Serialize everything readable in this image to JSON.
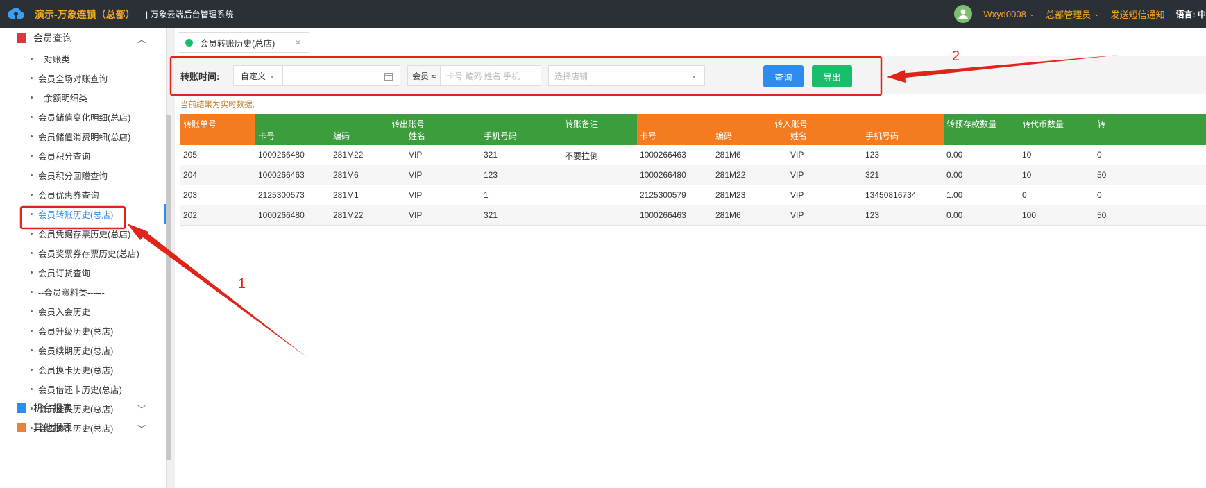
{
  "header": {
    "brand": "演示-万象连锁（总部）",
    "subtitle": "| 万象云端后台管理系统",
    "user": "Wxyd0008",
    "role": "总部管理员",
    "sms": "发送短信通知",
    "lang_label": "语言:",
    "lang_value": "中"
  },
  "sidebar": {
    "group_member": "会员查询",
    "items": [
      "--对账类------------",
      "会员全场对账查询",
      "--余额明细类------------",
      "会员储值变化明细(总店)",
      "会员储值消费明细(总店)",
      "会员积分查询",
      "会员积分回赠查询",
      "会员优惠券查询",
      "会员转账历史(总店)",
      "会员凭据存票历史(总店)",
      "会员奖票券存票历史(总店)",
      "会员订货查询",
      "--会员资料类------",
      "会员入会历史",
      "会员升级历史(总店)",
      "会员续期历史(总店)",
      "会员换卡历史(总店)",
      "会员借还卡历史(总店)",
      "会员挂失历史(总店)",
      "会员退卡历史(总店)"
    ],
    "active_index": 8,
    "group_machine": "机台报表",
    "group_other": "其他报表"
  },
  "tab": {
    "label": "会员转账历史(总店)",
    "close": "×"
  },
  "filter": {
    "label": "转账时间:",
    "range_select": "自定义",
    "date_value": "",
    "member_prefix": "会员 ≈",
    "member_placeholder": "卡号 编码 姓名 手机",
    "store_placeholder": "选择店铺",
    "query_button": "查询",
    "export_button": "导出"
  },
  "notice": "当前结果为实时数据;",
  "table": {
    "headers": {
      "order_no": "转账单号",
      "out_group": "转出账号",
      "remark": "转账备注",
      "in_group": "转入账号",
      "prepaid": "转预存款数量",
      "coin": "转代币数量",
      "more": "转",
      "card": "卡号",
      "code": "编码",
      "name": "姓名",
      "phone": "手机号码"
    },
    "rows": [
      [
        "205",
        "1000266480",
        "281M22",
        "VIP",
        "321",
        "不要拉倒",
        "1000266463",
        "281M6",
        "VIP",
        "123",
        "0.00",
        "10",
        "0"
      ],
      [
        "204",
        "1000266463",
        "281M6",
        "VIP",
        "123",
        "",
        "1000266480",
        "281M22",
        "VIP",
        "321",
        "0.00",
        "10",
        "50"
      ],
      [
        "203",
        "2125300573",
        "281M1",
        "VIP",
        "1",
        "",
        "2125300579",
        "281M23",
        "VIP",
        "13450816734",
        "1.00",
        "0",
        "0"
      ],
      [
        "202",
        "1000266480",
        "281M22",
        "VIP",
        "321",
        "",
        "1000266463",
        "281M6",
        "VIP",
        "123",
        "0.00",
        "100",
        "50"
      ]
    ]
  },
  "annotations": {
    "one": "1",
    "two": "2"
  },
  "colors": {
    "orange": "#f47b20",
    "green": "#3c9d3c",
    "blue": "#2d8cf0",
    "red": "#e2231a"
  }
}
